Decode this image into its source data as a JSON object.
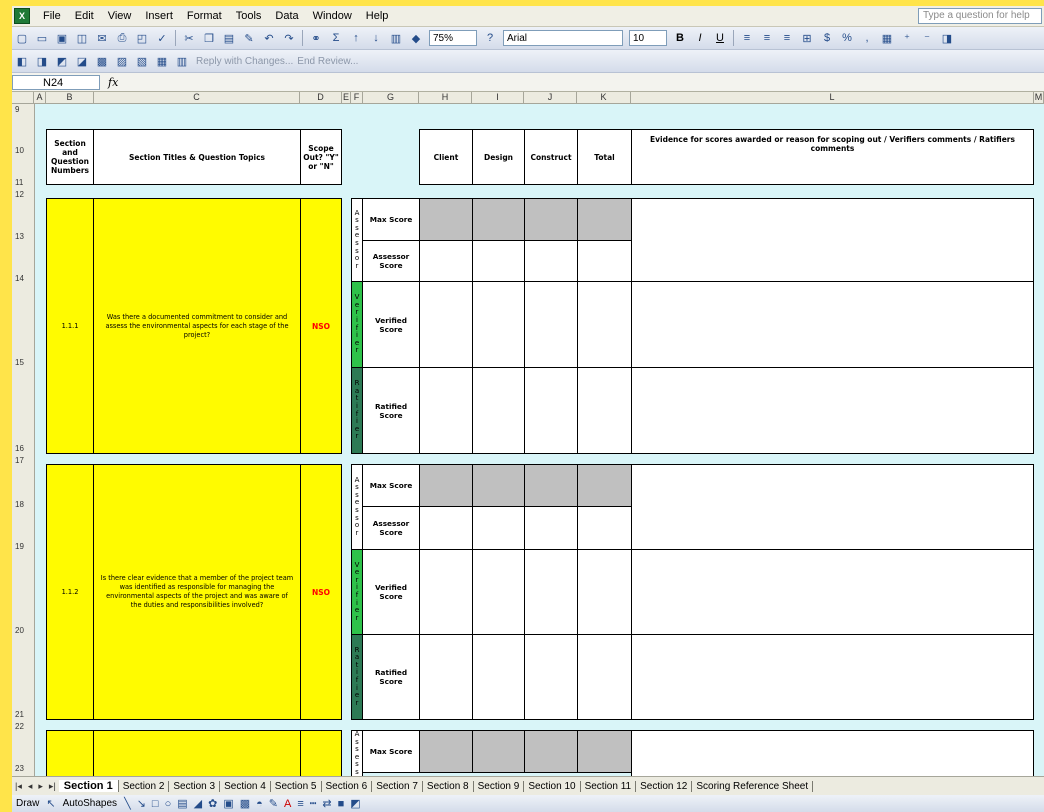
{
  "menubar": {
    "items": [
      "File",
      "Edit",
      "View",
      "Insert",
      "Format",
      "Tools",
      "Data",
      "Window",
      "Help"
    ],
    "help_placeholder": "Type a question for help"
  },
  "toolbar": {
    "zoom": "75%",
    "font_name": "Arial",
    "font_size": "10",
    "reply_text": "Reply with Changes...",
    "end_review": "End Review..."
  },
  "formula_bar": {
    "name_box": "N24",
    "fx": "fx"
  },
  "columns": [
    "A",
    "B",
    "C",
    "D",
    "E",
    "F",
    "G",
    "H",
    "I",
    "J",
    "K",
    "L",
    "M"
  ],
  "rows": [
    "9",
    "10",
    "11",
    "12",
    "13",
    "14",
    "15",
    "16",
    "17",
    "18",
    "19",
    "20",
    "21",
    "22",
    "23"
  ],
  "header": {
    "section_numbers": "Section and Question Numbers",
    "section_titles": "Section Titles & Question Topics",
    "scope_out": "Scope Out? \"Y\" or \"N\"",
    "client": "Client",
    "design": "Design",
    "construct": "Construct",
    "total": "Total",
    "evidence": "Evidence for scores awarded or reason for scoping out / Verifiers comments / Ratifiers comments"
  },
  "labels": {
    "max_score": "Max Score",
    "assessor_score": "Assessor Score",
    "verified_score": "Verified Score",
    "ratified_score": "Ratified Score",
    "assessor_vert": [
      "A",
      "s",
      "s",
      "e",
      "s",
      "s",
      "o",
      "r"
    ],
    "verifier_vert": [
      "V",
      "e",
      "r",
      "i",
      "f",
      "i",
      "e",
      "r"
    ],
    "ratifier_vert": [
      "R",
      "a",
      "t",
      "i",
      "f",
      "i",
      "e",
      "r"
    ]
  },
  "questions": [
    {
      "number": "1.1.1",
      "text": "Was there a documented commitment to consider and assess the environmental aspects for each stage of the project?",
      "scope": "NSO"
    },
    {
      "number": "1.1.2",
      "text": "Is there clear evidence that a member of the project team was identified as responsible for managing the environmental aspects of the project and was aware of the duties and responsibilities involved?",
      "scope": "NSO"
    }
  ],
  "sheet_tabs": [
    "Section 1",
    "Section 2",
    "Section 3",
    "Section 4",
    "Section 5",
    "Section 6",
    "Section 7",
    "Section 8",
    "Section 9",
    "Section 10",
    "Section 11",
    "Section 12",
    "Scoring Reference Sheet"
  ],
  "drawbar": {
    "draw": "Draw",
    "autoshapes": "AutoShapes"
  }
}
